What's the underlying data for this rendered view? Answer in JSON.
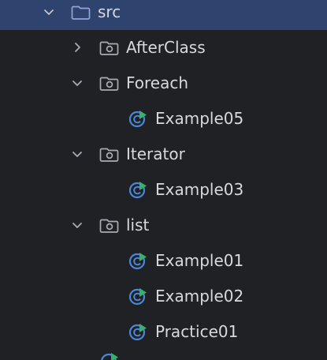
{
  "tree": {
    "root": {
      "label": "src",
      "icon": "folder-icon",
      "expanded": true,
      "selected": true
    },
    "items": [
      {
        "label": "AfterClass",
        "icon": "package-folder-icon",
        "expanded": false
      },
      {
        "label": "Foreach",
        "icon": "package-folder-icon",
        "expanded": true
      },
      {
        "label": "Example05",
        "icon": "java-class-run-icon"
      },
      {
        "label": "Iterator",
        "icon": "package-folder-icon",
        "expanded": true
      },
      {
        "label": "Example03",
        "icon": "java-class-run-icon"
      },
      {
        "label": "list",
        "icon": "package-folder-icon",
        "expanded": true
      },
      {
        "label": "Example01",
        "icon": "java-class-run-icon"
      },
      {
        "label": "Example02",
        "icon": "java-class-run-icon"
      },
      {
        "label": "Practice01",
        "icon": "java-class-run-icon"
      }
    ]
  },
  "colors": {
    "background": "#1f2125",
    "selected_row": "#2e436d",
    "text": "#d7d9dd",
    "chevron": "#a9adb3",
    "folder_outline": "#8ea6d8",
    "class_blue": "#4a86d6",
    "run_green": "#36b36a"
  }
}
